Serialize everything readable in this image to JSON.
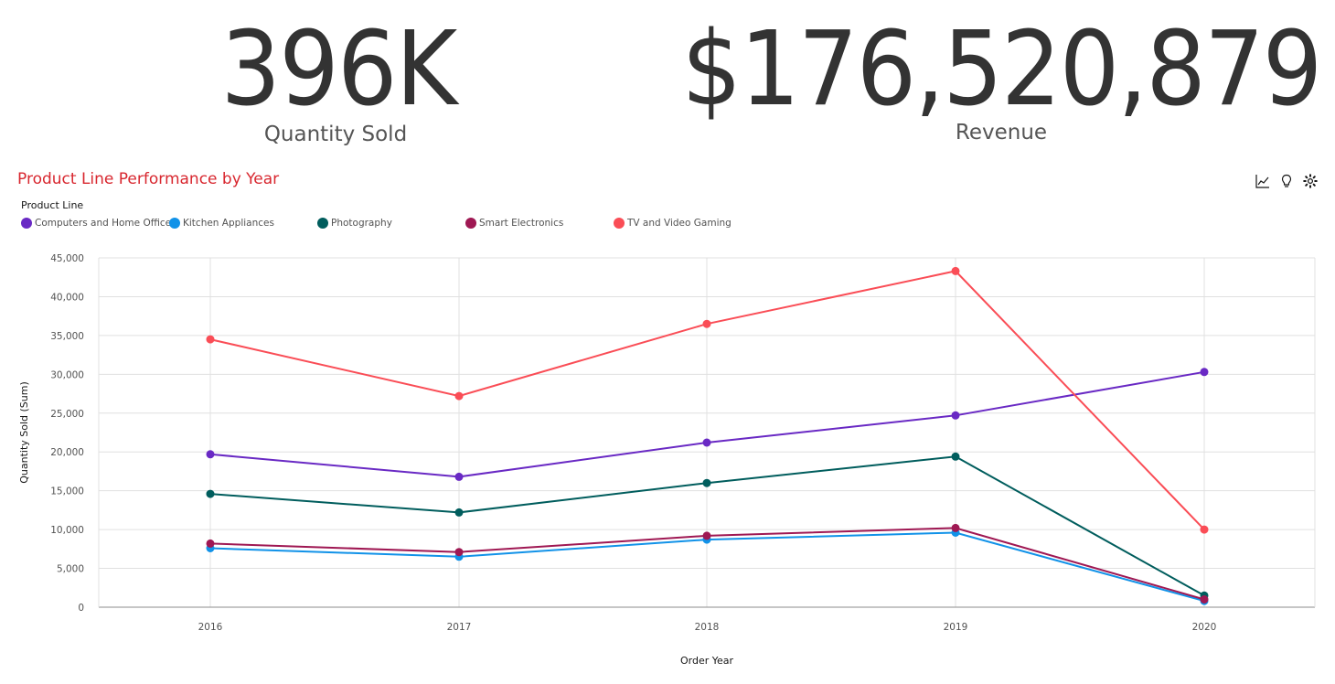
{
  "kpis": [
    {
      "value": "396K",
      "label": "Quantity Sold"
    },
    {
      "value": "$176,520,879",
      "label": "Revenue"
    }
  ],
  "chart_title": "Product Line Performance by Year",
  "toolbar": {
    "icons": [
      "line-chart-icon",
      "lightbulb-icon",
      "settings-icon"
    ]
  },
  "legend": {
    "title": "Product Line",
    "placement": "top-left"
  },
  "colors": {
    "title": "#d8272f",
    "kpi_text": "#333333",
    "grid": "#e0e0e0",
    "axis": "#8d8d8d"
  },
  "chart_data": {
    "type": "line",
    "title": "Product Line Performance by Year",
    "xlabel": "Order Year",
    "ylabel": "Quantity Sold (Sum)",
    "x": [
      "2016",
      "2017",
      "2018",
      "2019",
      "2020"
    ],
    "ylim": [
      0,
      45000
    ],
    "yticks": [
      0,
      5000,
      10000,
      15000,
      20000,
      25000,
      30000,
      35000,
      40000,
      45000
    ],
    "ytick_labels": [
      "0",
      "5,000",
      "10,000",
      "15,000",
      "20,000",
      "25,000",
      "30,000",
      "35,000",
      "40,000",
      "45,000"
    ],
    "grid": true,
    "series": [
      {
        "name": "Computers and Home Office",
        "color": "#6929c4",
        "values": [
          19700,
          16800,
          21200,
          24700,
          30300
        ]
      },
      {
        "name": "Kitchen Appliances",
        "color": "#1192e8",
        "values": [
          7600,
          6500,
          8700,
          9600,
          800
        ]
      },
      {
        "name": "Photography",
        "color": "#005d5d",
        "values": [
          14600,
          12200,
          16000,
          19400,
          1500
        ]
      },
      {
        "name": "Smart Electronics",
        "color": "#9f1853",
        "values": [
          8200,
          7100,
          9200,
          10200,
          1000
        ]
      },
      {
        "name": "TV and Video Gaming",
        "color": "#fa4d56",
        "values": [
          34500,
          27200,
          36500,
          43300,
          10000
        ]
      }
    ]
  }
}
